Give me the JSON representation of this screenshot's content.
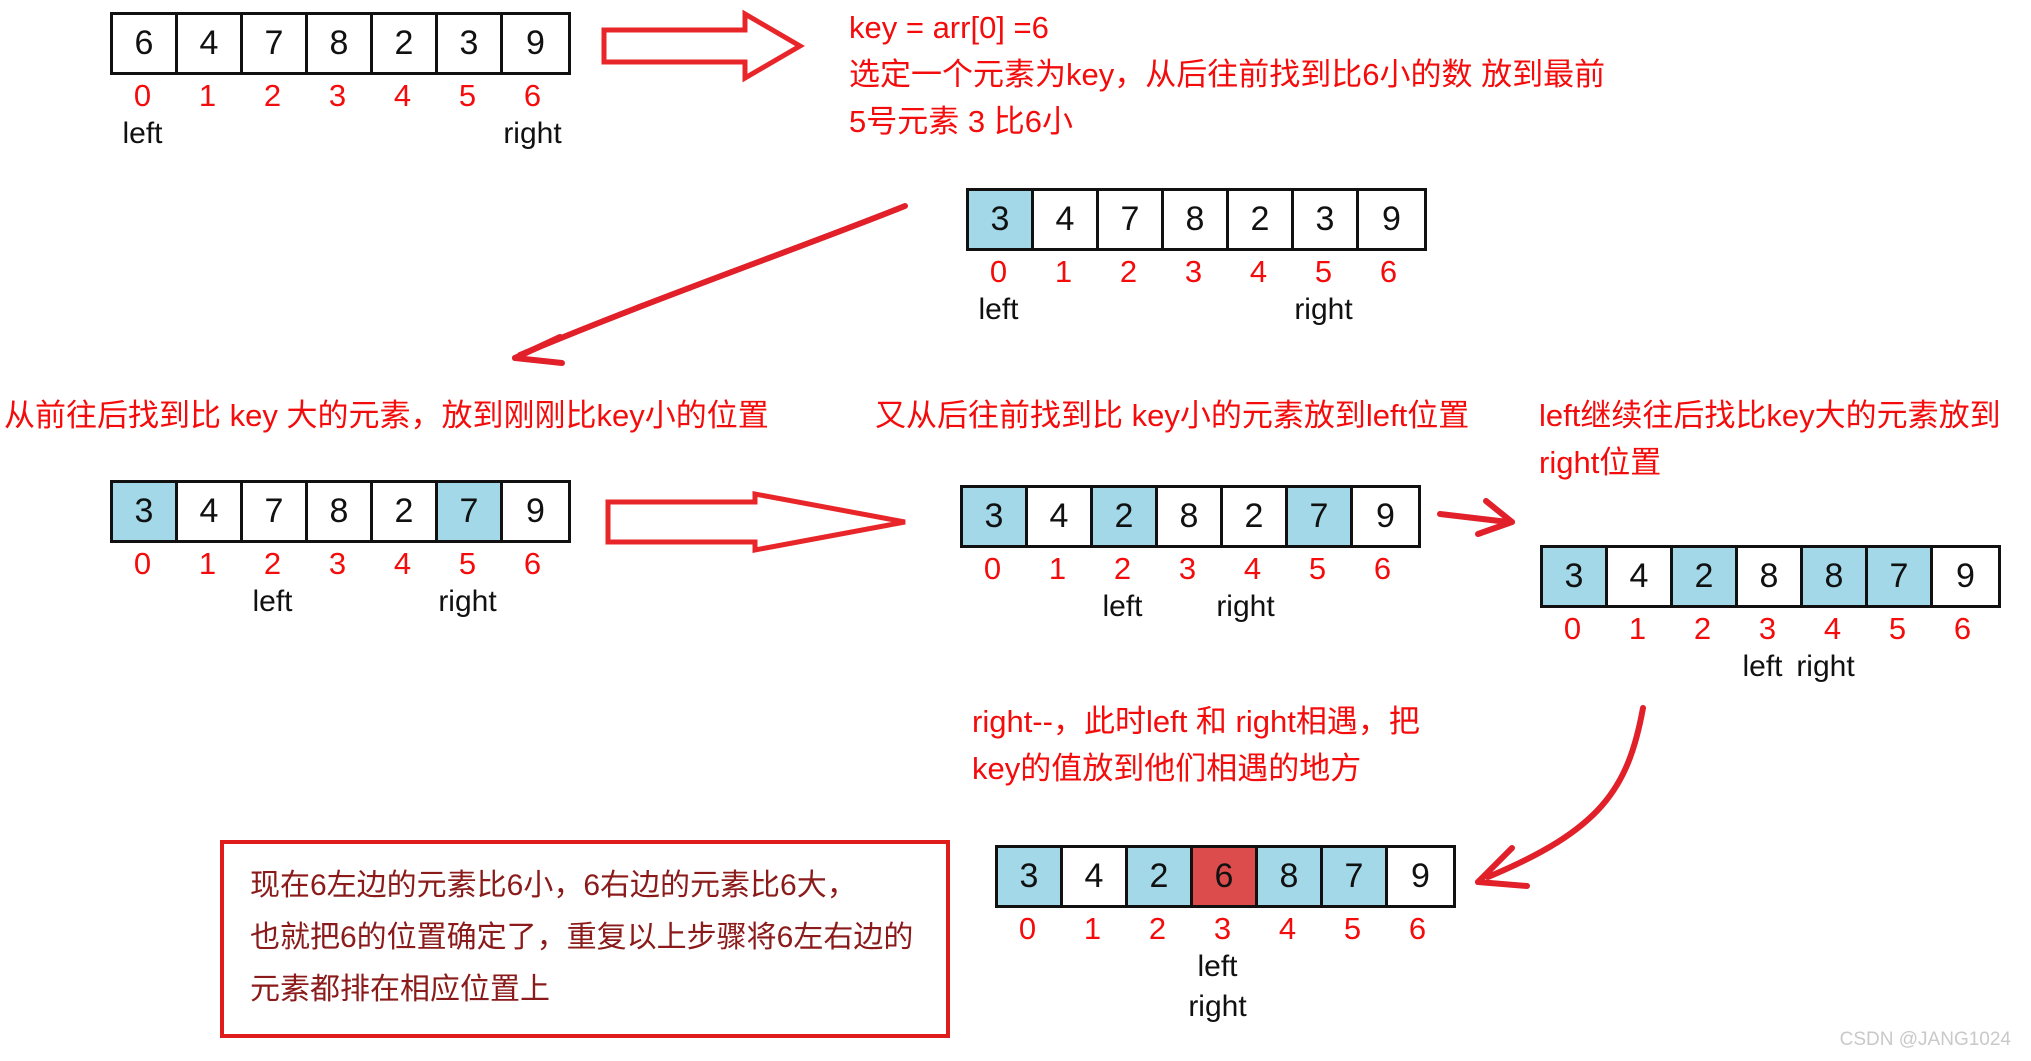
{
  "colors": {
    "highlight": "#a2d8e8",
    "key": "#dd4c4c",
    "red_text": "#f40c0c",
    "box_border": "#e01b1b",
    "box_text": "#8b1a1a",
    "cell_border": "#111111"
  },
  "arrays": [
    {
      "id": "array-initial",
      "values": [
        "6",
        "4",
        "7",
        "8",
        "2",
        "3",
        "9"
      ],
      "indices": [
        "0",
        "1",
        "2",
        "3",
        "4",
        "5",
        "6"
      ],
      "highlight": [],
      "key_cell": null,
      "pointers": [
        {
          "label": "left",
          "index": 0
        },
        {
          "label": "right",
          "index": 6
        }
      ]
    },
    {
      "id": "array-step1",
      "values": [
        "3",
        "4",
        "7",
        "8",
        "2",
        "3",
        "9"
      ],
      "indices": [
        "0",
        "1",
        "2",
        "3",
        "4",
        "5",
        "6"
      ],
      "highlight": [
        0
      ],
      "key_cell": null,
      "pointers": [
        {
          "label": "left",
          "index": 0
        },
        {
          "label": "right",
          "index": 5
        }
      ]
    },
    {
      "id": "array-step2",
      "values": [
        "3",
        "4",
        "7",
        "8",
        "2",
        "7",
        "9"
      ],
      "indices": [
        "0",
        "1",
        "2",
        "3",
        "4",
        "5",
        "6"
      ],
      "highlight": [
        0,
        5
      ],
      "key_cell": null,
      "pointers": [
        {
          "label": "left",
          "index": 2
        },
        {
          "label": "right",
          "index": 5
        }
      ]
    },
    {
      "id": "array-step3",
      "values": [
        "3",
        "4",
        "2",
        "8",
        "2",
        "7",
        "9"
      ],
      "indices": [
        "0",
        "1",
        "2",
        "3",
        "4",
        "5",
        "6"
      ],
      "highlight": [
        0,
        2,
        5
      ],
      "key_cell": null,
      "pointers": [
        {
          "label": "left",
          "index": 2
        },
        {
          "label": "right",
          "index": 4
        }
      ]
    },
    {
      "id": "array-step4",
      "values": [
        "3",
        "4",
        "2",
        "8",
        "8",
        "7",
        "9"
      ],
      "indices": [
        "0",
        "1",
        "2",
        "3",
        "4",
        "5",
        "6"
      ],
      "highlight": [
        0,
        2,
        4,
        5
      ],
      "key_cell": null,
      "pointers": [
        {
          "label": "left",
          "index": 3
        },
        {
          "label": "right",
          "index": 4
        }
      ]
    },
    {
      "id": "array-final",
      "values": [
        "3",
        "4",
        "2",
        "6",
        "8",
        "7",
        "9"
      ],
      "indices": [
        "0",
        "1",
        "2",
        "3",
        "4",
        "5",
        "6"
      ],
      "highlight": [
        0,
        2,
        4,
        5
      ],
      "key_cell": 3,
      "pointers": [
        {
          "label": "left",
          "index": 3
        },
        {
          "label": "right",
          "index": 3
        }
      ]
    }
  ],
  "notes": {
    "key_def": "key = arr[0] =6\n选定一个元素为key，从后往前找到比6小的数  放到最前\n5号元素 3 比6小",
    "forward_find": "从前往后找到比 key 大的元素，放到刚刚比key小的位置",
    "backward_find": "又从后往前找到比 key小的元素放到left位置",
    "left_continue": "left继续往后找比key大的元素放到\nright位置",
    "meet": "right--，此时left 和 right相遇，把\nkey的值放到他们相遇的地方",
    "summary": "现在6左边的元素比6小，6右边的元素比6大，\n也就把6的位置确定了，重复以上步骤将6左右边的\n元素都排在相应位置上"
  },
  "watermark": "CSDN @JANG1024"
}
